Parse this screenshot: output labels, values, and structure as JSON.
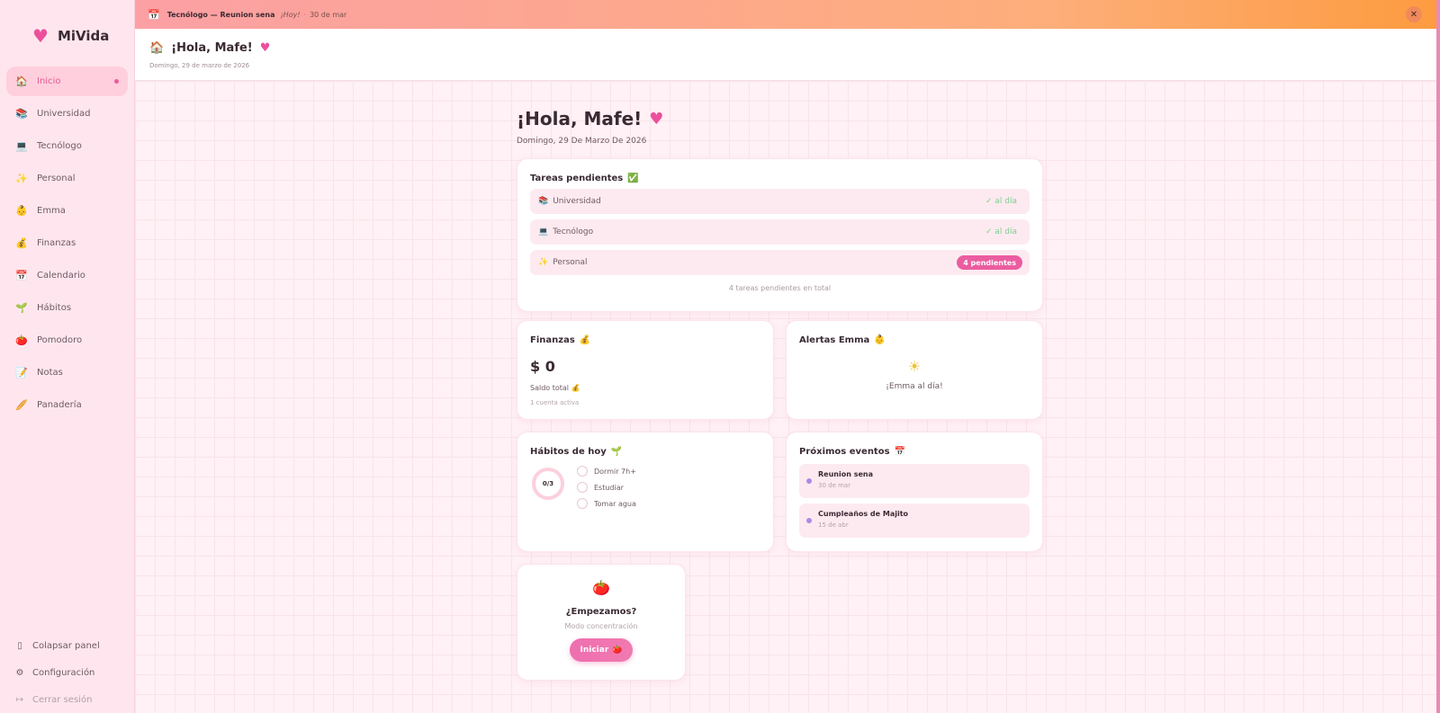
{
  "app": {
    "name": "MiVida"
  },
  "sidebar": {
    "items": [
      {
        "icon": "house-icon",
        "label": "Inicio",
        "active": true
      },
      {
        "icon": "books-icon",
        "label": "Universidad"
      },
      {
        "icon": "laptop-icon",
        "label": "Tecnólogo"
      },
      {
        "icon": "sparkles-icon",
        "label": "Personal"
      },
      {
        "icon": "baby-icon",
        "label": "Emma"
      },
      {
        "icon": "money-bag-icon",
        "label": "Finanzas"
      },
      {
        "icon": "calendar-icon",
        "label": "Calendario"
      },
      {
        "icon": "seedling-icon",
        "label": "Hábitos"
      },
      {
        "icon": "tomato-icon",
        "label": "Pomodoro"
      },
      {
        "icon": "memo-icon",
        "label": "Notas"
      },
      {
        "icon": "bread-icon",
        "label": "Panadería"
      }
    ],
    "bottom": [
      {
        "icon": "panel-icon",
        "label": "Colapsar panel"
      },
      {
        "icon": "gear-icon",
        "label": "Configuración"
      },
      {
        "icon": "logout-icon",
        "label": "Cerrar sesión"
      }
    ]
  },
  "banner": {
    "title": "Tecnólogo — Reunion sena",
    "hoy": "¡Hoy!",
    "separator": "·",
    "date": "30 de mar"
  },
  "header": {
    "title": "¡Hola, Mafe!",
    "date": "Domingo, 29 de marzo de 2026"
  },
  "greeting": {
    "title": "¡Hola, Mafe!",
    "date": "Domingo, 29 De Marzo De 2026"
  },
  "tasks": {
    "title": "Tareas pendientes",
    "rows": [
      {
        "label": "Universidad",
        "status": "✓ al día"
      },
      {
        "label": "Tecnólogo",
        "status": "✓ al día"
      },
      {
        "label": "Personal",
        "status": "4 pendientes"
      }
    ],
    "total": "4 tareas pendientes en total"
  },
  "finanzas": {
    "title": "Finanzas",
    "amount": "$ 0",
    "label": "Saldo total",
    "accounts": "1 cuenta activa"
  },
  "emma": {
    "title": "Alertas Emma",
    "message": "¡Emma al día!"
  },
  "habits": {
    "title": "Hábitos de hoy",
    "progress": "0/3",
    "items": [
      "Dormir 7h+",
      "Estudiar",
      "Tomar agua"
    ]
  },
  "events": {
    "title": "Próximos eventos",
    "items": [
      {
        "name": "Reunion sena",
        "date": "30 de mar"
      },
      {
        "name": "Cumpleaños de Majito",
        "date": "15 de abr"
      }
    ]
  },
  "pomodoro": {
    "question": "¿Empezamos?",
    "mode": "Modo concentración",
    "button": "Iniciar"
  },
  "colors": {
    "accent": "#ec5a9b",
    "sidebar_bg": "#ffe6ee",
    "main_bg": "#fff1f5",
    "success": "#7ccf8e",
    "event_dot": "#a98be6"
  }
}
